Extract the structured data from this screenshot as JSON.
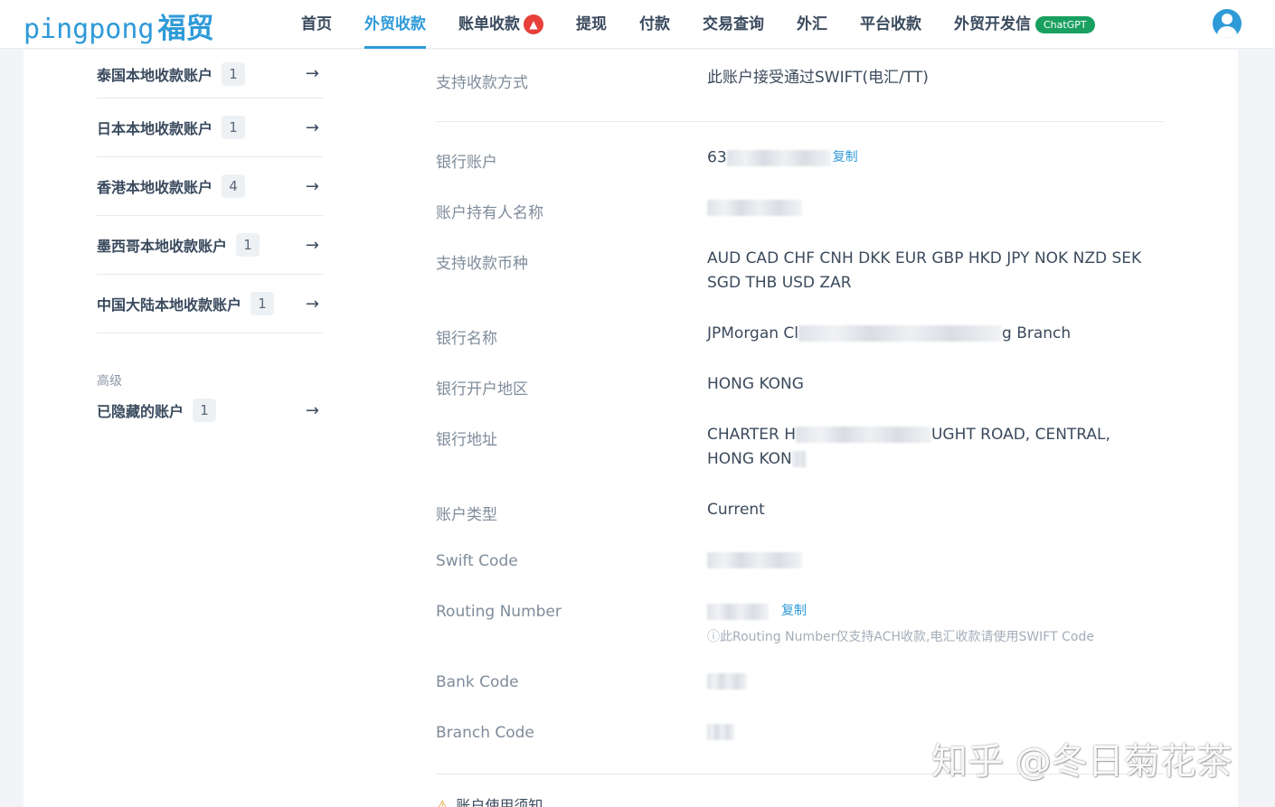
{
  "brand": {
    "logo_en": "pingpong",
    "logo_cn": "福贸"
  },
  "nav": {
    "items": [
      {
        "label": "首页"
      },
      {
        "label": "外贸收款",
        "active": true
      },
      {
        "label": "账单收款",
        "badge": "fire-icon"
      },
      {
        "label": "提现"
      },
      {
        "label": "付款"
      },
      {
        "label": "交易查询"
      },
      {
        "label": "外汇"
      },
      {
        "label": "平台收款"
      },
      {
        "label": "外贸开发信",
        "tag": "ChatGPT"
      }
    ]
  },
  "sidebar": {
    "items": [
      {
        "label": "泰国本地收款账户",
        "count": "1"
      },
      {
        "label": "日本本地收款账户",
        "count": "1"
      },
      {
        "label": "香港本地收款账户",
        "count": "4"
      },
      {
        "label": "墨西哥本地收款账户",
        "count": "1"
      },
      {
        "label": "中国大陆本地收款账户",
        "count": "1"
      }
    ],
    "advanced_title": "高级",
    "hidden_accounts": {
      "label": "已隐藏的账户",
      "count": "1"
    }
  },
  "details": {
    "methods": {
      "label": "支持收款方式",
      "value": "此账户接受通过SWIFT(电汇/TT)"
    },
    "account_no": {
      "label": "银行账户",
      "value_prefix": "63",
      "copy": "复制"
    },
    "holder": {
      "label": "账户持有人名称"
    },
    "currencies": {
      "label": "支持收款币种",
      "value": "AUD CAD CHF CNH DKK EUR GBP HKD JPY NOK NZD SEK SGD THB USD ZAR"
    },
    "bank_name": {
      "label": "银行名称",
      "value_start": "JPMorgan Cl",
      "value_end": "g Branch"
    },
    "region": {
      "label": "银行开户地区",
      "value": "HONG KONG"
    },
    "address": {
      "label": "银行地址",
      "line1_start": "CHARTER H",
      "line1_end": "UGHT ROAD, CENTRAL,",
      "line2": "HONG KON"
    },
    "account_type": {
      "label": "账户类型",
      "value": "Current"
    },
    "swift": {
      "label": "Swift Code"
    },
    "routing": {
      "label": "Routing Number",
      "copy": "复制",
      "note": "ⓘ此Routing Number仅支持ACH收款,电汇收款请使用SWIFT Code"
    },
    "bank_code": {
      "label": "Bank Code"
    },
    "branch_code": {
      "label": "Branch Code"
    }
  },
  "notice": {
    "label": "账户使用须知"
  },
  "watermark": "知乎 @冬日菊花茶"
}
